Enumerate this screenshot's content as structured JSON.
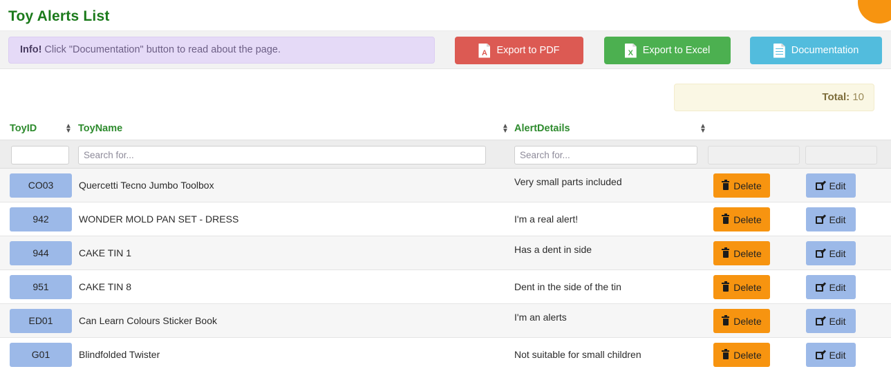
{
  "page": {
    "title": "Toy Alerts List"
  },
  "toolbar": {
    "alert": {
      "strong": "Info!",
      "text": " Click \"Documentation\" button to read about the page."
    },
    "buttons": [
      {
        "label": "Export to PDF",
        "icon": "pdf-file-icon",
        "color": "#dc5a53"
      },
      {
        "label": "Export to Excel",
        "icon": "excel-file-icon",
        "color": "#4cb050"
      },
      {
        "label": "Documentation",
        "icon": "doc-file-icon",
        "color": "#52bcdd"
      }
    ]
  },
  "summary": {
    "total_label": "Total:",
    "total_value": "10"
  },
  "table": {
    "columns": [
      {
        "label": "ToyID",
        "sortable": true
      },
      {
        "label": "ToyName",
        "sortable": true
      },
      {
        "label": "AlertDetails",
        "sortable": true
      }
    ],
    "filters": {
      "toyid_value": "",
      "toyid_placeholder": "",
      "toyname_placeholder": "Search for...",
      "alertdetails_placeholder": "Search for...",
      "action1_placeholder": "",
      "action2_placeholder": ""
    },
    "action_labels": {
      "delete": "Delete",
      "edit": "Edit"
    },
    "rows": [
      {
        "toyid": "CO03",
        "toyname": "Quercetti Tecno Jumbo Toolbox",
        "alertdetails": "Very small parts included"
      },
      {
        "toyid": "942",
        "toyname": "WONDER MOLD PAN SET - DRESS",
        "alertdetails": "I'm a real alert!"
      },
      {
        "toyid": "944",
        "toyname": "CAKE TIN 1",
        "alertdetails": "Has a dent in side"
      },
      {
        "toyid": "951",
        "toyname": "CAKE TIN 8",
        "alertdetails": "Dent in the side of the tin"
      },
      {
        "toyid": "ED01",
        "toyname": "Can Learn Colours Sticker Book",
        "alertdetails": "I'm an alerts"
      },
      {
        "toyid": "G01",
        "toyname": "Blindfolded Twister",
        "alertdetails": "Not suitable for small children"
      }
    ]
  },
  "colors": {
    "title_green": "#1b7a1b",
    "header_green": "#2e8b2e",
    "info_bg": "#e5daf7",
    "pdf_red": "#dc5a53",
    "excel_green": "#4cb050",
    "doc_blue": "#52bcdd",
    "total_bg": "#faf7e4",
    "id_badge_blue": "#9cb9e8",
    "delete_orange": "#f79410",
    "edit_blue": "#9cb9e8",
    "fab_orange": "#f79410"
  }
}
